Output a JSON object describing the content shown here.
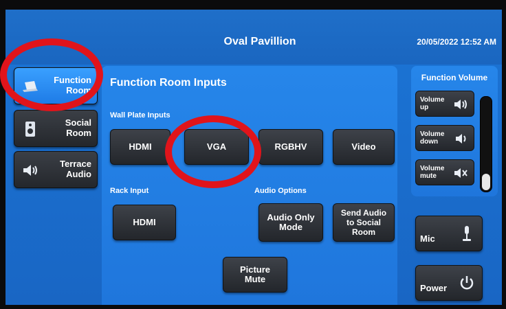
{
  "header": {
    "title": "Oval Pavillion",
    "datetime": "20/05/2022 12:52 AM"
  },
  "nav": {
    "items": [
      {
        "label": "Function\nRoom",
        "icon": "laptop-icon",
        "active": true
      },
      {
        "label": "Social\nRoom",
        "icon": "speaker-icon",
        "active": false
      },
      {
        "label": "Terrace\nAudio",
        "icon": "speaker-volume-icon",
        "active": false
      }
    ]
  },
  "main": {
    "title": "Function Room Inputs",
    "wall_plate_label": "Wall Plate Inputs",
    "wall_plate_buttons": [
      "HDMI",
      "VGA",
      "RGBHV",
      "Video"
    ],
    "rack_label": "Rack Input",
    "rack_button": "HDMI",
    "audio_options_label": "Audio Options",
    "audio_only_button": "Audio Only\nMode",
    "send_audio_button": "Send Audio\nto Social\nRoom",
    "picture_mute_button": "Picture\nMute"
  },
  "volume": {
    "title": "Function Volume",
    "up_label": "Volume\nup",
    "down_label": "Volume\ndown",
    "mute_label": "Volume\nmute",
    "level": 0.18
  },
  "side": {
    "mic_label": "Mic",
    "power_label": "Power"
  },
  "colors": {
    "screen_blue": "#1c75d6",
    "active_blue": "#2a8ff5",
    "button_dark": "#2f3238",
    "annotation_red": "#e0141b"
  }
}
